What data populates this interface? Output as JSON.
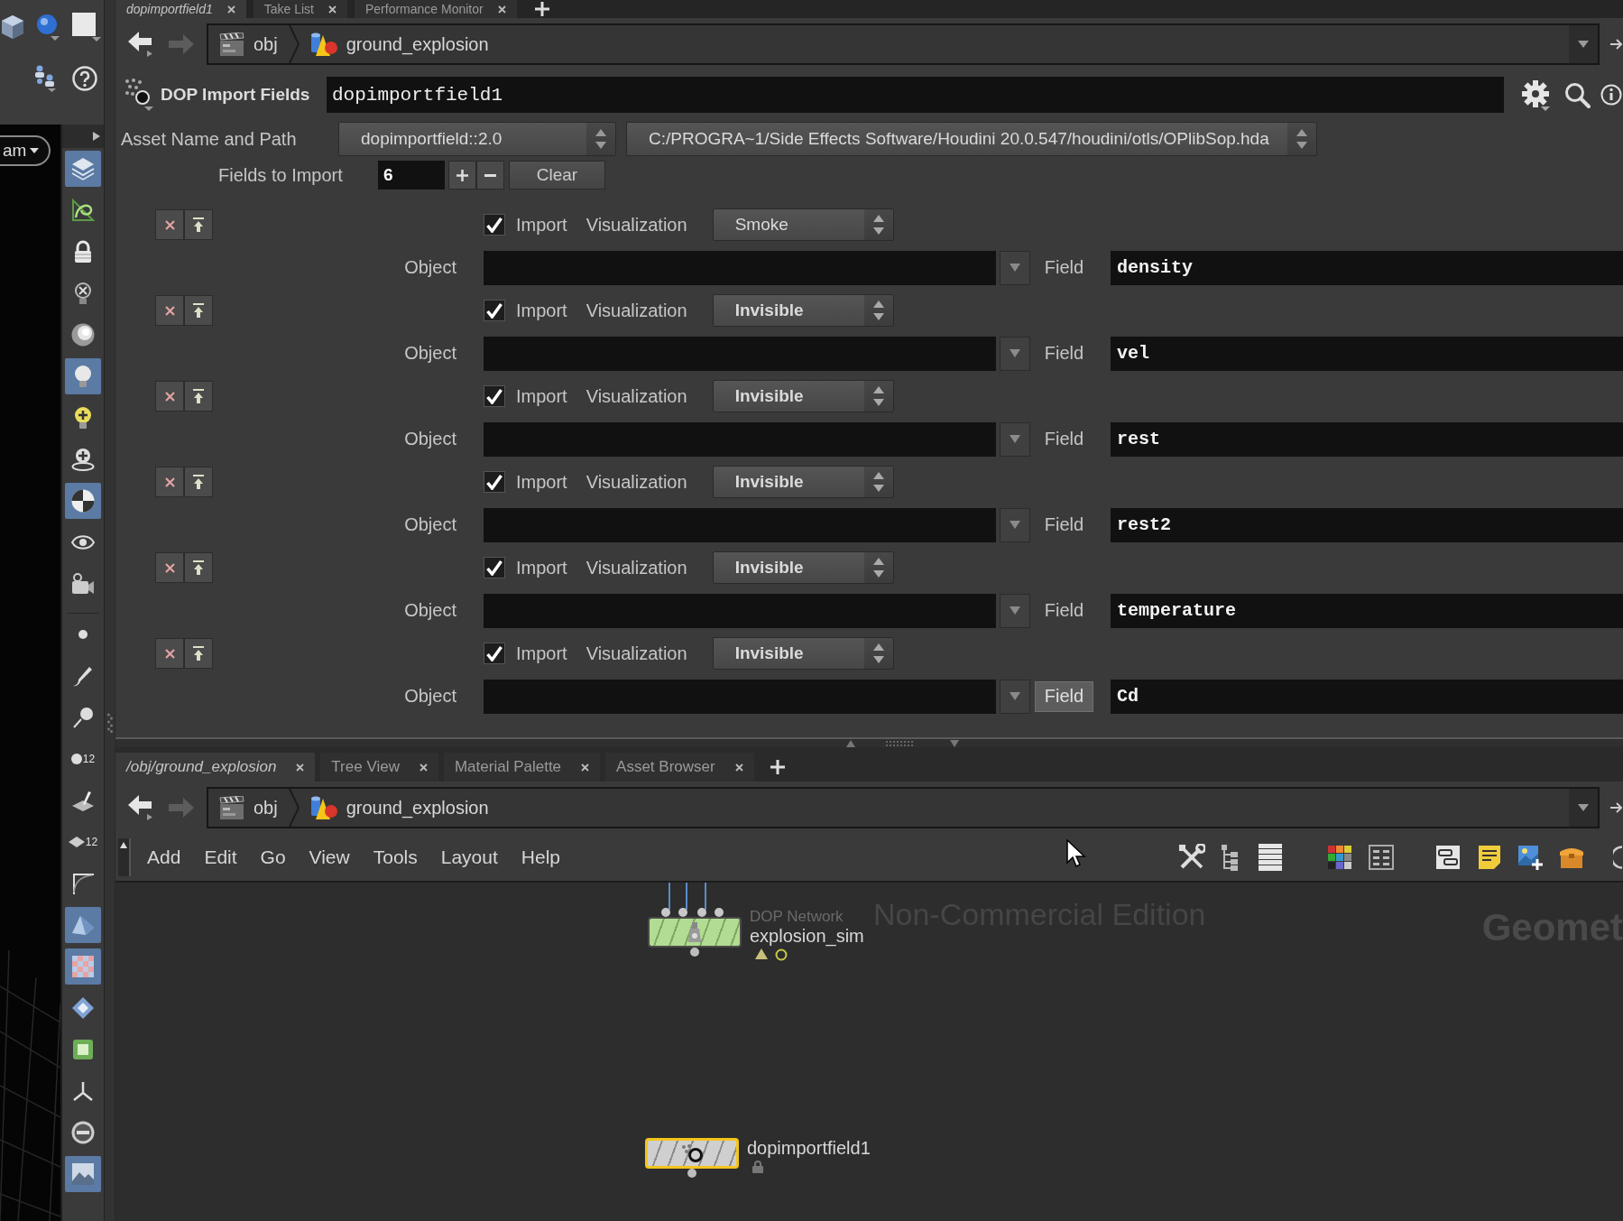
{
  "top_tabs": [
    {
      "label": "dopimportfield1",
      "selected": true
    },
    {
      "label": "Take List",
      "selected": false
    },
    {
      "label": "Performance Monitor",
      "selected": false
    }
  ],
  "path_bar": {
    "back_disabled": false,
    "forward_disabled": true,
    "crumbs": [
      "obj",
      "ground_explosion"
    ]
  },
  "parameters": {
    "node_type": "DOP Import Fields",
    "node_name": "dopimportfield1",
    "asset_label": "Asset Name and Path",
    "asset_name": "dopimportfield::2.0",
    "asset_path": "C:/PROGRA~1/Side Effects Software/Houdini 20.0.547/houdini/otls/OPlibSop.hda",
    "fields_label": "Fields to Import",
    "fields_count": "6",
    "clear_label": "Clear",
    "entries": [
      {
        "import": true,
        "import_label": "Import",
        "visualization_label": "Visualization",
        "visualization": "Smoke",
        "modified": false,
        "object_label": "Object",
        "field_label": "Field",
        "field_highlighted": false,
        "field": "density"
      },
      {
        "import": true,
        "import_label": "Import",
        "visualization_label": "Visualization",
        "visualization": "Invisible",
        "modified": true,
        "object_label": "Object",
        "field_label": "Field",
        "field_highlighted": false,
        "field": "vel"
      },
      {
        "import": true,
        "import_label": "Import",
        "visualization_label": "Visualization",
        "visualization": "Invisible",
        "modified": true,
        "object_label": "Object",
        "field_label": "Field",
        "field_highlighted": false,
        "field": "rest"
      },
      {
        "import": true,
        "import_label": "Import",
        "visualization_label": "Visualization",
        "visualization": "Invisible",
        "modified": true,
        "object_label": "Object",
        "field_label": "Field",
        "field_highlighted": false,
        "field": "rest2"
      },
      {
        "import": true,
        "import_label": "Import",
        "visualization_label": "Visualization",
        "visualization": "Invisible",
        "modified": true,
        "object_label": "Object",
        "field_label": "Field",
        "field_highlighted": false,
        "field": "temperature"
      },
      {
        "import": true,
        "import_label": "Import",
        "visualization_label": "Visualization",
        "visualization": "Invisible",
        "modified": true,
        "object_label": "Object",
        "field_label": "Field",
        "field_highlighted": true,
        "field": "Cd"
      }
    ]
  },
  "viewport": {
    "camera_menu": "am"
  },
  "display_toolbar": {
    "groups": [
      {
        "items": [
          {
            "selected": true
          },
          {
            "selected": false
          },
          {
            "selected": false
          },
          {
            "selected": false
          },
          {
            "selected": false
          },
          {
            "selected": true
          },
          {
            "selected": false
          },
          {
            "selected": false
          },
          {
            "selected": true
          },
          {
            "selected": false
          },
          {
            "selected": false
          }
        ]
      },
      {
        "items": [
          {
            "selected": false
          },
          {
            "selected": false
          },
          {
            "selected": false
          },
          {
            "selected": false,
            "label": "12"
          },
          {
            "selected": false
          },
          {
            "selected": false,
            "label": "12"
          },
          {
            "selected": false
          },
          {
            "selected": true
          },
          {
            "selected": true
          },
          {
            "selected": false
          },
          {
            "selected": false
          },
          {
            "selected": false
          },
          {
            "selected": false
          },
          {
            "selected": true
          }
        ]
      }
    ]
  },
  "network_tabs": [
    {
      "label": "/obj/ground_explosion",
      "selected": true
    },
    {
      "label": "Tree View",
      "selected": false
    },
    {
      "label": "Material Palette",
      "selected": false
    },
    {
      "label": "Asset Browser",
      "selected": false
    }
  ],
  "network_path_bar": {
    "back_disabled": false,
    "forward_disabled": true,
    "crumbs": [
      "obj",
      "ground_explosion"
    ]
  },
  "network_menu": [
    "Add",
    "Edit",
    "Go",
    "View",
    "Tools",
    "Layout",
    "Help"
  ],
  "network": {
    "edition_label": "Non-Commercial Edition",
    "context_label": "Geomet",
    "nodes": [
      {
        "kind": "dopnet",
        "type_label": "DOP Network",
        "name": "explosion_sim",
        "selected": false
      },
      {
        "kind": "dopimport",
        "name": "dopimportfield1",
        "selected": true
      }
    ]
  }
}
